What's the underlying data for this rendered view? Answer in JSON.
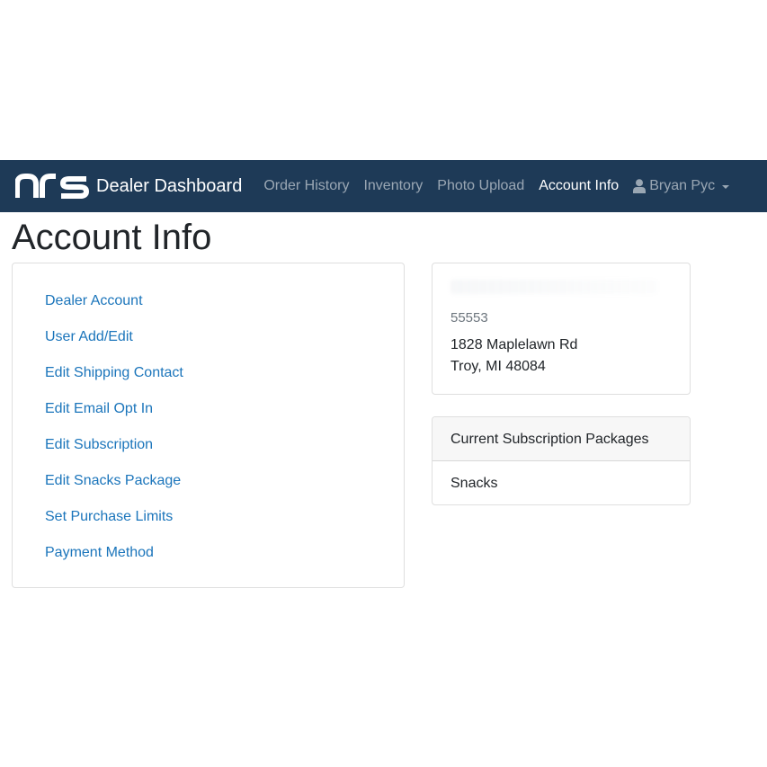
{
  "navbar": {
    "brand_text": "Dealer Dashboard",
    "links": [
      {
        "label": "Order History"
      },
      {
        "label": "Inventory"
      },
      {
        "label": "Photo Upload"
      },
      {
        "label": "Account Info"
      }
    ],
    "active_link": "Account Info",
    "user_name": "Bryan Pyc",
    "background_color": "#1e3a57"
  },
  "page": {
    "title": "Account Info"
  },
  "account_menu": {
    "items": [
      {
        "label": "Dealer Account"
      },
      {
        "label": "User Add/Edit"
      },
      {
        "label": "Edit Shipping Contact"
      },
      {
        "label": "Edit Email Opt In"
      },
      {
        "label": "Edit Subscription"
      },
      {
        "label": "Edit Snacks Package"
      },
      {
        "label": "Set Purchase Limits"
      },
      {
        "label": "Payment Method"
      }
    ],
    "link_color": "#1b75bb"
  },
  "address": {
    "dealer_number": "55553",
    "street": "1828 Maplelawn Rd",
    "city_state_zip": "Troy, MI 48084"
  },
  "subscription": {
    "header": "Current Subscription Packages",
    "packages": [
      {
        "name": "Snacks"
      }
    ]
  }
}
